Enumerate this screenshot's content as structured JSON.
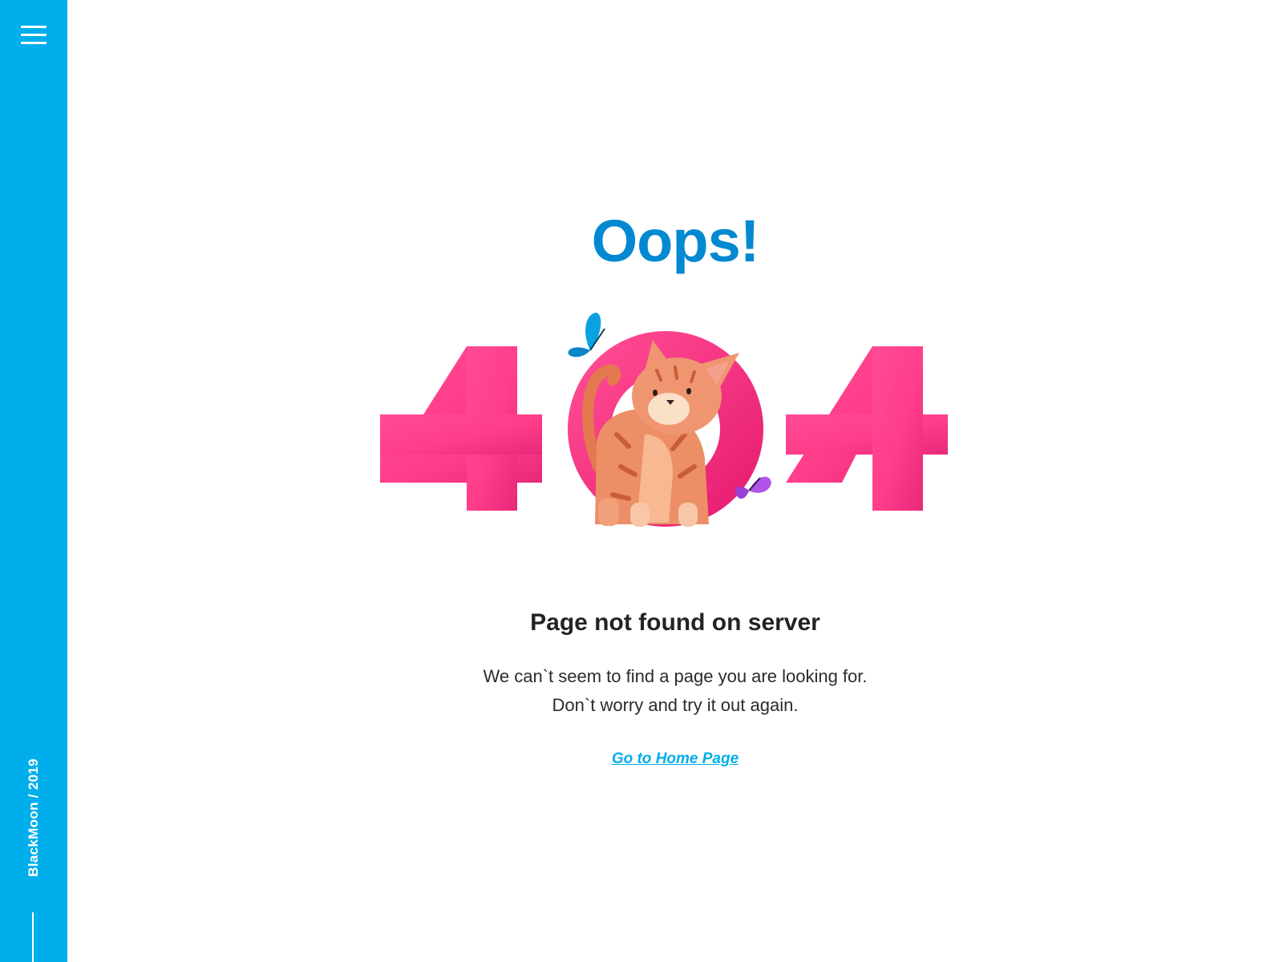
{
  "sidebar": {
    "menu_icon": "hamburger-menu-icon",
    "brand": "BlackMoon / 2019",
    "color": "#00aeeb"
  },
  "main": {
    "title": "Oops!",
    "error_code_digits": [
      "4",
      "0",
      "4"
    ],
    "heading": "Page not found on server",
    "description": [
      "We can`t seem to find a page you are looking for.",
      "Don`t worry and try it out again."
    ],
    "link_label": "Go to Home Page"
  },
  "illustration": {
    "icons": [
      "butterfly-icon",
      "cat-icon",
      "butterfly-icon"
    ]
  },
  "colors": {
    "title": "#0289d1",
    "digits": "#ff3d8b",
    "link": "#00aeeb",
    "heading": "#232323"
  }
}
